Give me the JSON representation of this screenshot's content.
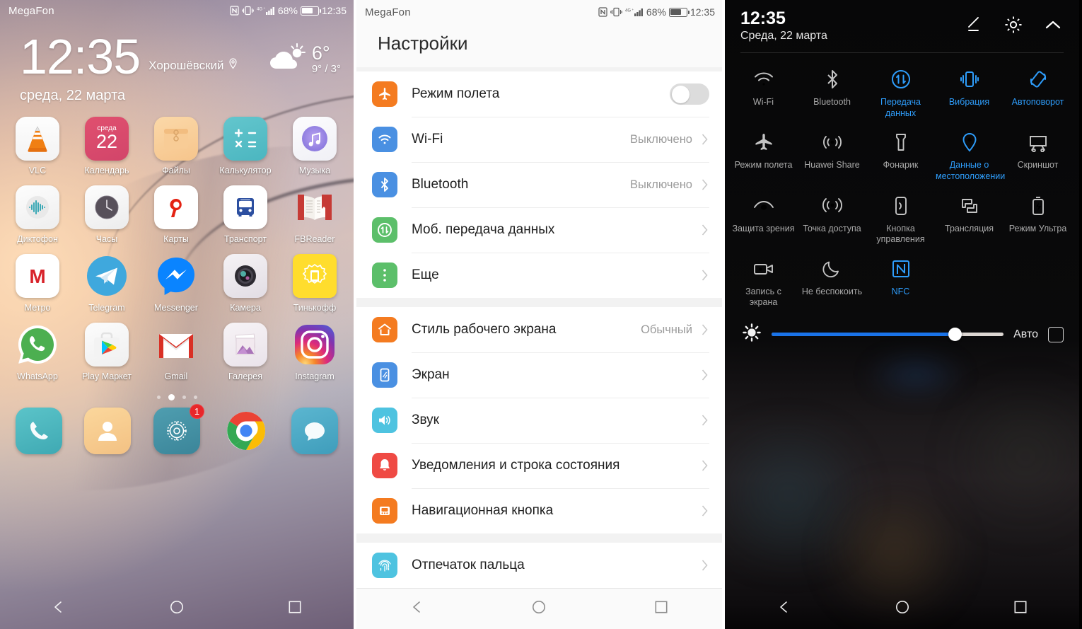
{
  "home": {
    "statusbar": {
      "carrier": "MegaFon",
      "battery_pct": "68%",
      "time": "12:35",
      "network": "4G+",
      "icons": [
        "nfc-icon",
        "vibrate-icon",
        "signal-icon",
        "battery-icon"
      ]
    },
    "clock_widget": {
      "time": "12:35",
      "location": "Хорошёвский",
      "date": "среда, 22 марта",
      "weather_temp": "6°",
      "weather_range": "9° / 3°"
    },
    "apps": [
      [
        {
          "label": "VLC",
          "icon": "vlc-icon"
        },
        {
          "label": "Календарь",
          "icon": "calendar-icon",
          "day": "22",
          "weekday": "среда"
        },
        {
          "label": "Файлы",
          "icon": "files-icon"
        },
        {
          "label": "Калькулятор",
          "icon": "calculator-icon"
        },
        {
          "label": "Музыка",
          "icon": "music-icon"
        }
      ],
      [
        {
          "label": "Диктофон",
          "icon": "recorder-icon"
        },
        {
          "label": "Часы",
          "icon": "clock-icon"
        },
        {
          "label": "Карты",
          "icon": "yandex-maps-icon"
        },
        {
          "label": "Транспорт",
          "icon": "transport-icon"
        },
        {
          "label": "FBReader",
          "icon": "fbreader-icon"
        }
      ],
      [
        {
          "label": "Метро",
          "icon": "metro-icon"
        },
        {
          "label": "Telegram",
          "icon": "telegram-icon"
        },
        {
          "label": "Messenger",
          "icon": "messenger-icon"
        },
        {
          "label": "Камера",
          "icon": "camera-icon"
        },
        {
          "label": "Тинькофф",
          "icon": "tinkoff-icon"
        }
      ],
      [
        {
          "label": "WhatsApp",
          "icon": "whatsapp-icon"
        },
        {
          "label": "Play Маркет",
          "icon": "play-store-icon"
        },
        {
          "label": "Gmail",
          "icon": "gmail-icon"
        },
        {
          "label": "Галерея",
          "icon": "gallery-icon"
        },
        {
          "label": "Instagram",
          "icon": "instagram-icon"
        }
      ]
    ],
    "page_dots": {
      "count": 4,
      "active_index": 1
    },
    "dock": [
      {
        "name": "phone-icon",
        "badge": ""
      },
      {
        "name": "contacts-icon",
        "badge": ""
      },
      {
        "name": "settings-gear-icon",
        "badge": "1"
      },
      {
        "name": "chrome-icon",
        "badge": ""
      },
      {
        "name": "messages-icon",
        "badge": ""
      }
    ],
    "navbar": [
      "back-icon",
      "home-icon",
      "recents-icon"
    ]
  },
  "settings": {
    "statusbar": {
      "carrier": "MegaFon",
      "battery_pct": "68%",
      "time": "12:35"
    },
    "title": "Настройки",
    "groups": [
      {
        "rows": [
          {
            "label": "Режим полета",
            "icon": "airplane-icon",
            "color": "#f47b20",
            "control": "toggle",
            "toggle_on": false,
            "value": ""
          },
          {
            "label": "Wi-Fi",
            "icon": "wifi-icon",
            "color": "#4a90e2",
            "control": "chevron",
            "value": "Выключено"
          },
          {
            "label": "Bluetooth",
            "icon": "bluetooth-icon",
            "color": "#4a90e2",
            "control": "chevron",
            "value": "Выключено"
          },
          {
            "label": "Моб. передача данных",
            "icon": "mobile-data-icon",
            "color": "#5cbf6a",
            "control": "chevron",
            "value": ""
          },
          {
            "label": "Еще",
            "icon": "more-dots-icon",
            "color": "#5cbf6a",
            "control": "chevron",
            "value": ""
          }
        ]
      },
      {
        "rows": [
          {
            "label": "Стиль рабочего экрана",
            "icon": "home-style-icon",
            "color": "#f47b20",
            "control": "chevron",
            "value": "Обычный"
          },
          {
            "label": "Экран",
            "icon": "display-icon",
            "color": "#4a90e2",
            "control": "chevron",
            "value": ""
          },
          {
            "label": "Звук",
            "icon": "sound-icon",
            "color": "#4ec3e0",
            "control": "chevron",
            "value": ""
          },
          {
            "label": "Уведомления и строка состояния",
            "icon": "bell-icon",
            "color": "#ef4a44",
            "control": "chevron",
            "value": ""
          },
          {
            "label": "Навигационная кнопка",
            "icon": "nav-button-icon",
            "color": "#f47b20",
            "control": "chevron",
            "value": ""
          }
        ]
      },
      {
        "rows": [
          {
            "label": "Отпечаток пальца",
            "icon": "fingerprint-icon",
            "color": "#4ec3e0",
            "control": "chevron",
            "value": ""
          }
        ]
      }
    ],
    "navbar": [
      "back-icon",
      "home-icon",
      "recents-icon"
    ]
  },
  "quick_settings": {
    "time": "12:35",
    "date": "Среда, 22 марта",
    "actions": [
      "edit-pencil-icon",
      "gear-icon",
      "collapse-chevron-icon"
    ],
    "tiles": [
      {
        "label": "Wi-Fi",
        "icon": "wifi-icon",
        "state": "off"
      },
      {
        "label": "Bluetooth",
        "icon": "bluetooth-icon",
        "state": "off"
      },
      {
        "label": "Передача данных",
        "icon": "mobile-data-icon",
        "state": "on"
      },
      {
        "label": "Вибрация",
        "icon": "vibrate-icon",
        "state": "on"
      },
      {
        "label": "Автоповорот",
        "icon": "autorotate-icon",
        "state": "on"
      },
      {
        "label": "Режим полета",
        "icon": "airplane-icon",
        "state": "off"
      },
      {
        "label": "Huawei Share",
        "icon": "huawei-share-icon",
        "state": "off"
      },
      {
        "label": "Фонарик",
        "icon": "flashlight-icon",
        "state": "off"
      },
      {
        "label": "Данные о местоположении",
        "icon": "location-pin-icon",
        "state": "on"
      },
      {
        "label": "Скриншот",
        "icon": "screenshot-icon",
        "state": "off"
      },
      {
        "label": "Защита зрения",
        "icon": "eye-comfort-icon",
        "state": "off"
      },
      {
        "label": "Точка доступа",
        "icon": "hotspot-icon",
        "state": "off"
      },
      {
        "label": "Кнопка управления",
        "icon": "control-button-icon",
        "state": "off"
      },
      {
        "label": "Трансляция",
        "icon": "cast-icon",
        "state": "off"
      },
      {
        "label": "Режим Ультра",
        "icon": "ultra-power-icon",
        "state": "off"
      },
      {
        "label": "Запись с экрана",
        "icon": "screen-record-icon",
        "state": "off"
      },
      {
        "label": "Не беспокоить",
        "icon": "do-not-disturb-icon",
        "state": "off"
      },
      {
        "label": "NFC",
        "icon": "nfc-icon",
        "state": "on"
      }
    ],
    "brightness": {
      "value_pct": 79,
      "auto_label": "Авто",
      "auto_checked": false
    },
    "navbar": [
      "back-icon",
      "home-icon",
      "recents-icon"
    ]
  },
  "colors": {
    "accent_blue": "#2e9dfb",
    "slider_blue": "#1a73e8",
    "badge_red": "#e8262a"
  }
}
